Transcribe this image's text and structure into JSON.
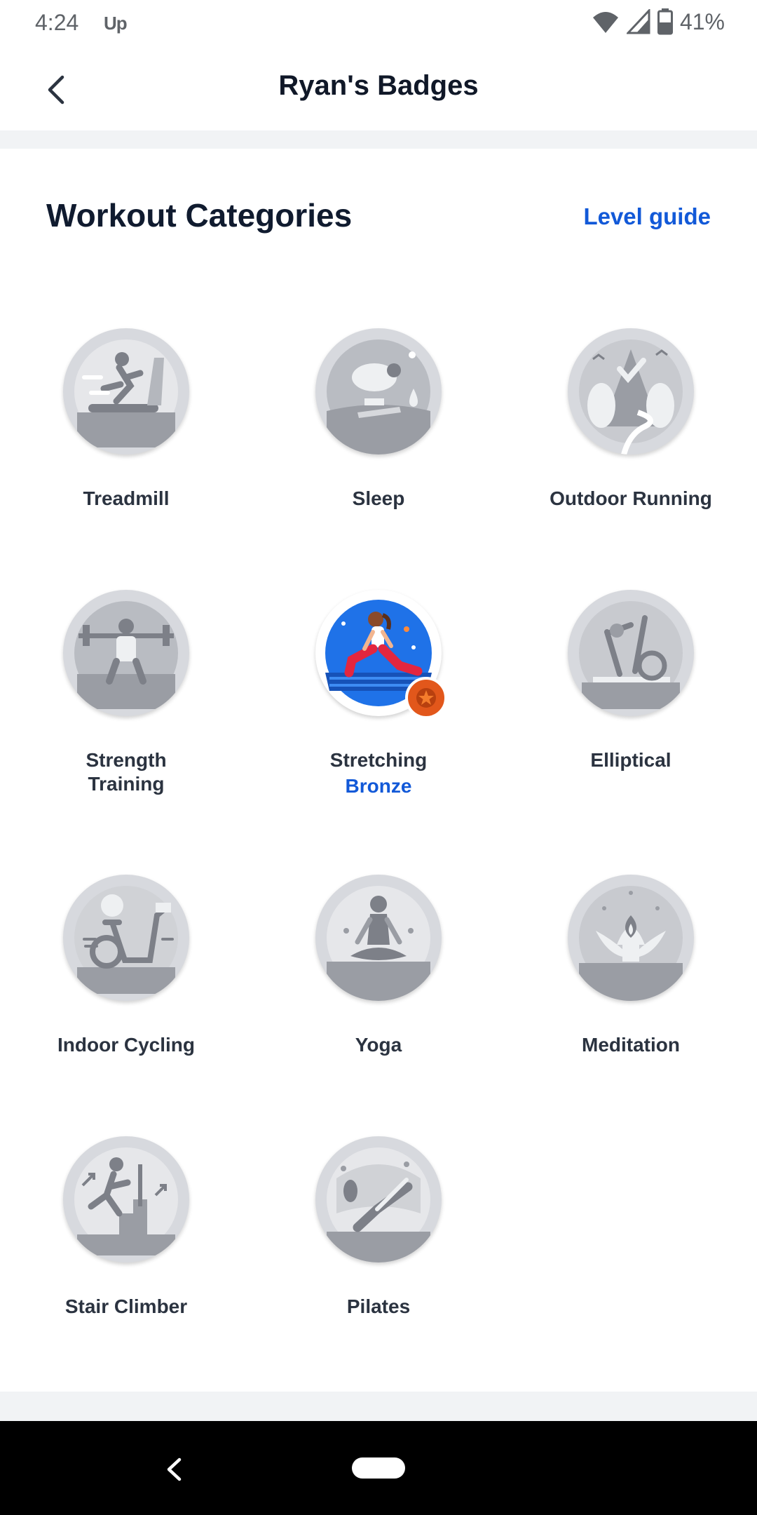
{
  "status_bar": {
    "time": "4:24",
    "app_indicator": "Up",
    "battery": "41%",
    "icons": [
      "wifi-icon",
      "signal-icon",
      "battery-icon"
    ]
  },
  "header": {
    "title": "Ryan's Badges",
    "back_icon": "chevron-left-icon"
  },
  "section": {
    "title": "Workout Categories",
    "link": "Level guide"
  },
  "badges": [
    {
      "label": "Treadmill",
      "level": "",
      "earned": false,
      "icon": "treadmill-badge-icon"
    },
    {
      "label": "Sleep",
      "level": "",
      "earned": false,
      "icon": "sleep-badge-icon"
    },
    {
      "label": "Outdoor Running",
      "level": "",
      "earned": false,
      "icon": "outdoor-running-badge-icon"
    },
    {
      "label": "Strength Training",
      "level": "",
      "earned": false,
      "icon": "strength-training-badge-icon"
    },
    {
      "label": "Stretching",
      "level": "Bronze",
      "earned": true,
      "icon": "stretching-badge-icon"
    },
    {
      "label": "Elliptical",
      "level": "",
      "earned": false,
      "icon": "elliptical-badge-icon"
    },
    {
      "label": "Indoor Cycling",
      "level": "",
      "earned": false,
      "icon": "indoor-cycling-badge-icon"
    },
    {
      "label": "Yoga",
      "level": "",
      "earned": false,
      "icon": "yoga-badge-icon"
    },
    {
      "label": "Meditation",
      "level": "",
      "earned": false,
      "icon": "meditation-badge-icon"
    },
    {
      "label": "Stair Climber",
      "level": "",
      "earned": false,
      "icon": "stair-climber-badge-icon"
    },
    {
      "label": "Pilates",
      "level": "",
      "earned": false,
      "icon": "pilates-badge-icon"
    }
  ],
  "colors": {
    "accent": "#1259d8",
    "bronze": "#e2571b",
    "badge_gray": "#d7d9de",
    "badge_dark": "#9a9da4",
    "stretch_blue": "#1f72e8"
  },
  "nav_bar": {
    "back_icon": "nav-back-icon",
    "home_icon": "nav-home-pill-icon"
  }
}
